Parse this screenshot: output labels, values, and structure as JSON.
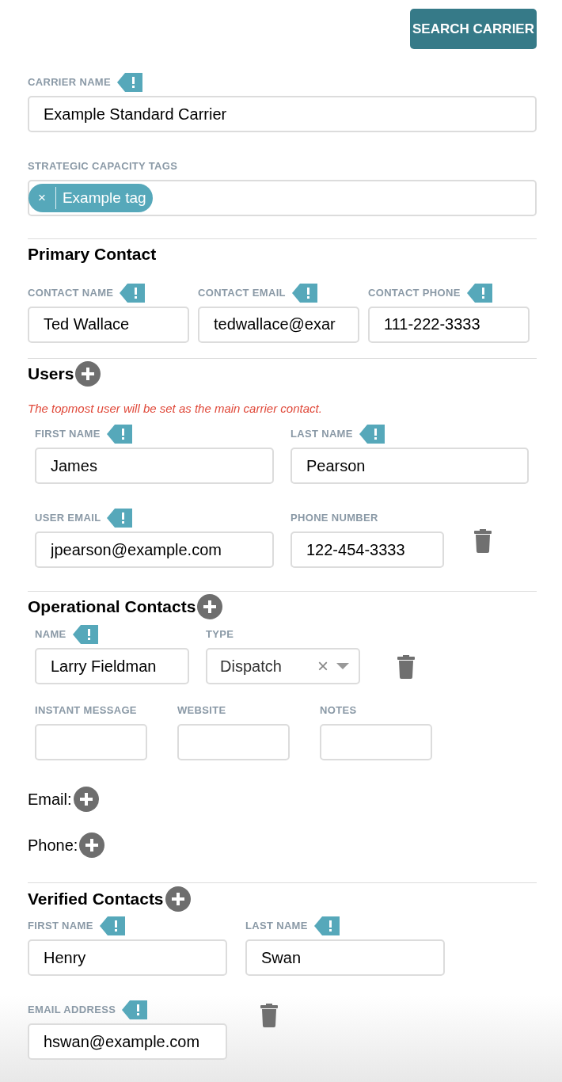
{
  "search_button": "SEARCH CARRIER",
  "carrier_name": {
    "label": "CARRIER NAME",
    "required": true,
    "value": "Example Standard Carrier"
  },
  "tags_field": {
    "label": "STRATEGIC CAPACITY TAGS",
    "required": false,
    "tags": [
      {
        "label": "Example tag",
        "remove": "×"
      }
    ]
  },
  "primary_contact": {
    "title": "Primary Contact",
    "fields": [
      {
        "label": "CONTACT NAME",
        "required": true,
        "value": "Ted Wallace"
      },
      {
        "label": "CONTACT EMAIL",
        "required": true,
        "value": "tedwallace@exar"
      },
      {
        "label": "CONTACT PHONE",
        "required": true,
        "value": "111-222-3333"
      }
    ]
  },
  "users": {
    "title": "Users",
    "note": "The topmost user will be set as the main carrier contact.",
    "items": [
      {
        "first_name": {
          "label": "FIRST NAME",
          "required": true,
          "value": "James"
        },
        "last_name": {
          "label": "LAST NAME",
          "required": true,
          "value": "Pearson"
        },
        "email": {
          "label": "USER EMAIL",
          "required": true,
          "value": "jpearson@example.com"
        },
        "phone": {
          "label": "PHONE NUMBER",
          "required": false,
          "value": "122-454-3333"
        }
      }
    ]
  },
  "operational_contacts": {
    "title": "Operational Contacts",
    "items": [
      {
        "name": {
          "label": "NAME",
          "required": true,
          "value": "Larry Fieldman"
        },
        "type": {
          "label": "TYPE",
          "required": false,
          "value": "Dispatch",
          "clear": "×"
        },
        "extra_fields": [
          {
            "label": "INSTANT MESSAGE",
            "required": false
          },
          {
            "label": "WEBSITE",
            "required": false
          },
          {
            "label": "NOTES",
            "required": false
          }
        ]
      }
    ],
    "email_label": "Email:",
    "phone_label": "Phone:"
  },
  "verified_contacts": {
    "title": "Verified Contacts",
    "items": [
      {
        "first_name": {
          "label": "FIRST NAME",
          "required": true,
          "value": "Henry"
        },
        "last_name": {
          "label": "LAST NAME",
          "required": true,
          "value": "Swan"
        },
        "email": {
          "label": "EMAIL ADDRESS",
          "required": true,
          "value": "hswan@example.com"
        }
      }
    ]
  }
}
